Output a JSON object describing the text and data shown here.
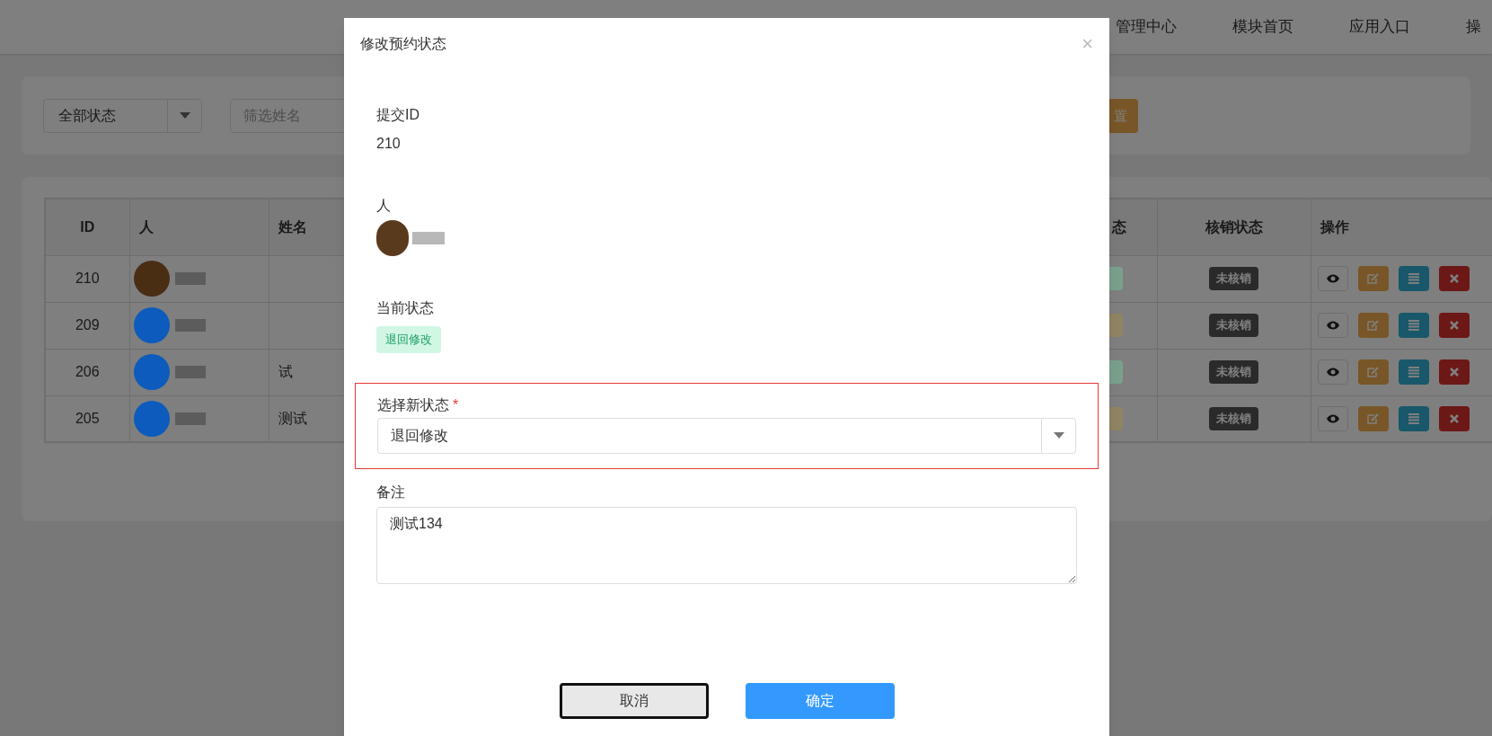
{
  "nav": {
    "items": [
      "管理中心",
      "模块首页",
      "应用入口",
      "操"
    ]
  },
  "filter": {
    "status_select": "全部状态",
    "name_field": {
      "placeholder": "筛选姓名"
    },
    "reset_button": "置"
  },
  "table": {
    "columns": [
      "ID",
      "人",
      "姓名",
      "态",
      "核销状态",
      "操作"
    ],
    "rows": [
      {
        "id": "210",
        "avatar": {
          "color": "#4a2e14"
        },
        "status": {
          "color": "#79a08c"
        },
        "verify": "未核销"
      },
      {
        "id": "209",
        "avatar": {
          "color": "#0c5bbd"
        },
        "status": {
          "color": "#8f8562"
        },
        "verify": "未核销"
      },
      {
        "id": "206",
        "avatar": {
          "color": "#0c5bbd"
        },
        "name": "试",
        "status": {
          "color": "#79a08c"
        },
        "verify": "未核销"
      },
      {
        "id": "205",
        "avatar": {
          "color": "#0c5bbd"
        },
        "name": "测试",
        "status": {
          "color": "#8f8562"
        },
        "verify": "未核销"
      }
    ]
  },
  "modal": {
    "title": "修改预约状态",
    "close": "×",
    "fields": [
      {
        "kind": "text",
        "label": "提交ID",
        "value": "210"
      },
      {
        "kind": "user",
        "label": "人",
        "avatar": {
          "color": "#5a3a1c"
        }
      },
      {
        "kind": "tag",
        "label": "当前状态",
        "value": "退回修改"
      },
      {
        "kind": "select",
        "label": "选择新状态",
        "required_mark": "*",
        "error": true,
        "value": "退回修改"
      },
      {
        "kind": "textarea",
        "label": "备注",
        "value": "测试134"
      }
    ],
    "buttons": [
      {
        "label": "取消",
        "kind": "default",
        "focused": true
      },
      {
        "label": "确定",
        "kind": "primary",
        "focused": false
      }
    ]
  }
}
